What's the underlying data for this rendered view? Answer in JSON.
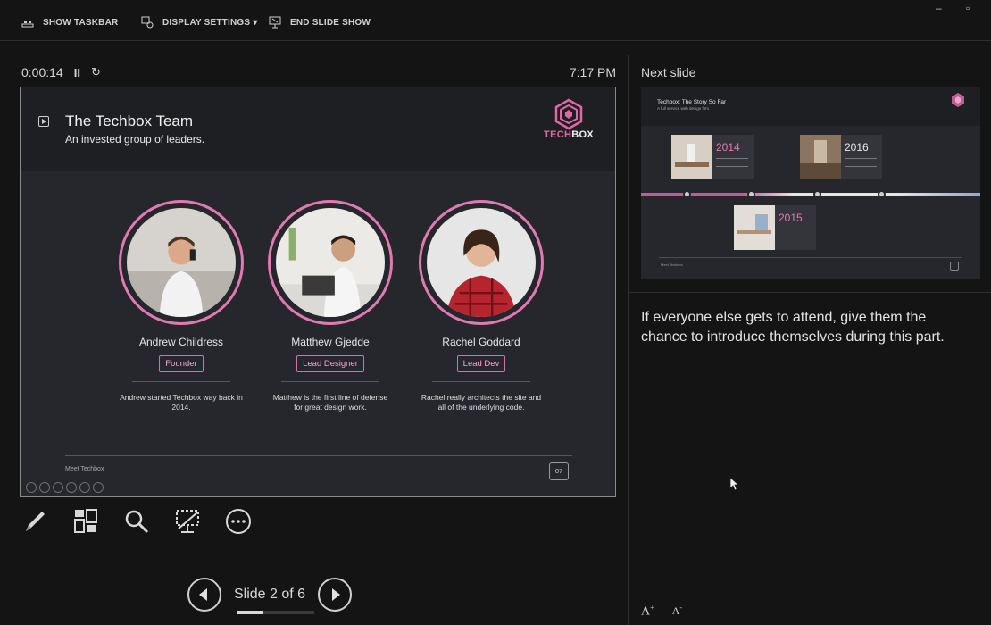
{
  "toolbar": {
    "show_taskbar": "SHOW TASKBAR",
    "display_settings": "DISPLAY SETTINGS ▾",
    "end_slide_show": "END SLIDE SHOW",
    "window_minimize": "–",
    "window_restore": "▫"
  },
  "presenter": {
    "elapsed": "0:00:14",
    "pause_symbol": "II",
    "restart_symbol": "↻",
    "clock": "7:17 PM"
  },
  "current_slide": {
    "title": "The Techbox Team",
    "subtitle": "An invested group of leaders.",
    "logo_tech": "TECH",
    "logo_box": "BOX",
    "team": [
      {
        "name": "Andrew Childress",
        "role": "Founder",
        "description": "Andrew started Techbox way back in 2014."
      },
      {
        "name": "Matthew Gjedde",
        "role": "Lead Designer",
        "description": "Matthew is the first line of defense for great design work."
      },
      {
        "name": "Rachel Goddard",
        "role": "Lead Dev",
        "description": "Rachel really architects the site and all of the underlying code."
      }
    ],
    "footer_label": "Meet Techbox",
    "slide_number": "07"
  },
  "tools": {
    "icons": [
      "pen-icon",
      "see-all-slides-icon",
      "zoom-icon",
      "black-screen-icon",
      "more-options-icon"
    ]
  },
  "navigation": {
    "label": "Slide 2 of 6",
    "progress": 0.333
  },
  "next_slide": {
    "label": "Next slide",
    "title": "Techbox: The Story So Far",
    "subtitle": "A full service web design firm",
    "timeline": [
      {
        "year": "2014"
      },
      {
        "year": "2016"
      },
      {
        "year": "2015"
      }
    ],
    "footer_label": "Meet Techbox"
  },
  "notes": {
    "text": "If everyone else gets to attend, give them the chance to introduce themselves during this part."
  },
  "font_controls": {
    "increase": "A",
    "decrease": "A"
  },
  "colors": {
    "accent_pink": "#e07ab0",
    "background": "#141414",
    "slide_bg": "#26272c"
  }
}
